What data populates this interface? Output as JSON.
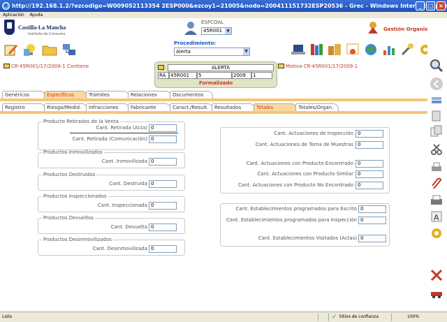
{
  "window": {
    "title": "http://192.168.1.2/?ezcodigo=W009052113354 2ESP000&ezcoy1=21005&nodo=200411151732ESP20536 - Grec - Windows Internet Explorer"
  },
  "menu": {
    "items": [
      "Aplicación",
      "Ayuda"
    ]
  },
  "header": {
    "logo_title": "Castilla-La Mancha",
    "logo_subtitle": "Instituto de Consumo",
    "user_label": "ESPCOAL",
    "user_value": "45R001",
    "gestion_label": "Gestión Organismo",
    "procedimiento_label": "Procedimiento:",
    "procedimiento_value": "Alerta"
  },
  "links": {
    "left": "CR-45R001/17/2009-1 Contiene",
    "right": "Motiva CR-45R001/17/2009-1"
  },
  "alert": {
    "title": "ALERTA",
    "cells": [
      "RA",
      "45R001",
      "5",
      "2009",
      "1"
    ],
    "status": "Formalizado"
  },
  "tabs_main": [
    "Genéricos",
    "Específicos",
    "Trámites",
    "Relaciones",
    "Documentos"
  ],
  "tabs_sub": [
    "Registro",
    "Riesgo/Medid.",
    "Infracciones",
    "Fabricante",
    "Caract./Result.",
    "Resultados",
    "Totales",
    "Totales/Organ."
  ],
  "left_groups": [
    {
      "legend": "Producto Retirados de la Venta",
      "fields": [
        {
          "label": "Cant. Retirada (Acta)",
          "value": "0"
        },
        {
          "label": "Cant. Retirada (Comunicación)",
          "value": "0"
        }
      ]
    },
    {
      "legend": "Productos Inmovilizados",
      "fields": [
        {
          "label": "Cant. Inmovilizada",
          "value": "0"
        }
      ]
    },
    {
      "legend": "Productos Destruidos",
      "fields": [
        {
          "label": "Cant. Destruida",
          "value": "0"
        }
      ]
    },
    {
      "legend": "Productos Inspeccionados",
      "fields": [
        {
          "label": "Cant. Inspeccionada",
          "value": "0"
        }
      ]
    },
    {
      "legend": "Productos Devueltos",
      "fields": [
        {
          "label": "Cant. Devuelta",
          "value": "0"
        }
      ]
    },
    {
      "legend": "Productos Desinmovilizados",
      "fields": [
        {
          "label": "Cant. Desinmovilizada",
          "value": "0"
        }
      ]
    }
  ],
  "right_group1": [
    {
      "label": "Cant. Actuaciones de Inspección",
      "value": "0"
    },
    {
      "label": "Cant. Actuaciones de Toma de Muestras",
      "value": "0"
    },
    {
      "label": "Cant. Actuaciones con Producto Encontrado",
      "value": "0"
    },
    {
      "label": "Cant. Actuaciones con Producto Similar",
      "value": "0"
    },
    {
      "label": "Cant. Actuaciones con Producto No Encontrado",
      "value": "0"
    }
  ],
  "right_group2": [
    {
      "label": "Cant. Establecimientos programados para Escrito",
      "value": "0"
    },
    {
      "label": "Cant. Establecimientos programados para Inspección",
      "value": "0"
    },
    {
      "label": "Cant. Establecimientos Visitados (Actas)",
      "value": "0"
    }
  ],
  "status": {
    "text": "Listo",
    "trust": "Sitios de confianza",
    "zoom": "100%"
  }
}
